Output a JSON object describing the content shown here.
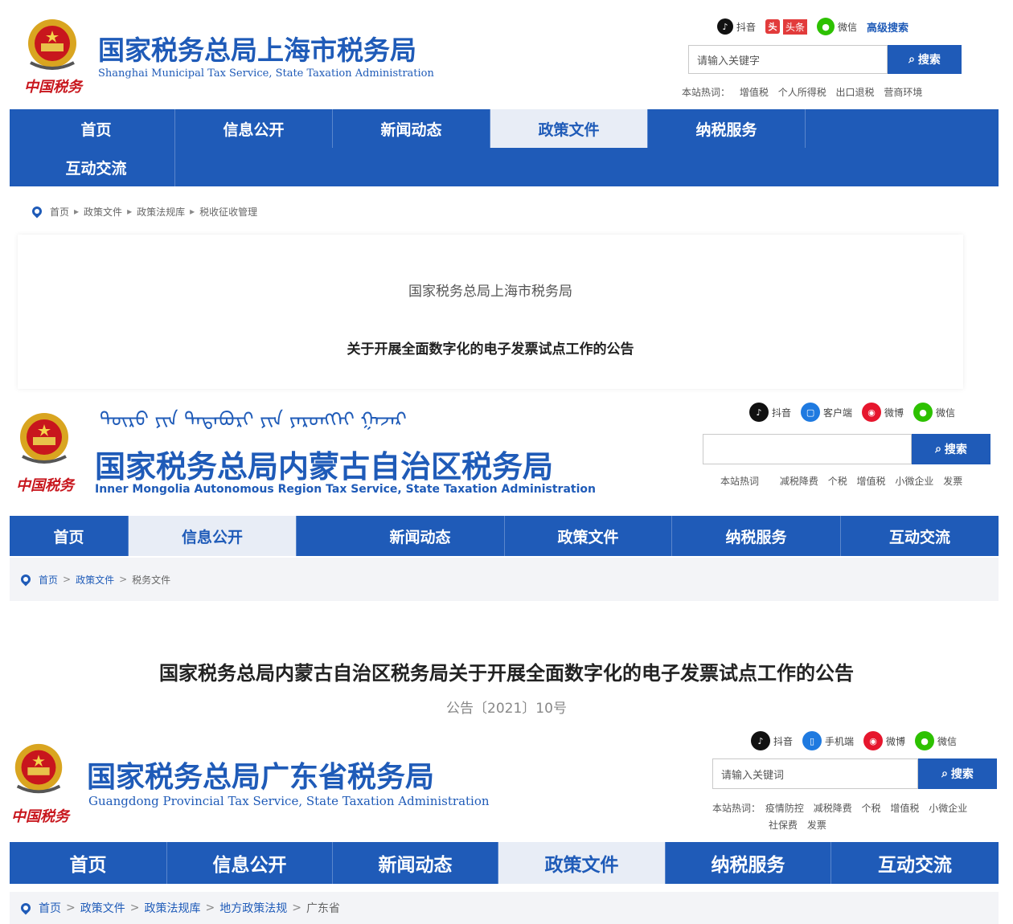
{
  "colors": {
    "brand_blue": "#1f5bb8",
    "calligraphy_red": "#c8161d",
    "nav_active_bg": "#e8edf6"
  },
  "shanghai": {
    "title": "国家税务总局上海市税务局",
    "subtitle": "Shanghai Municipal Tax Service, State Taxation Administration",
    "calligraphy": "中国税务",
    "social": [
      {
        "icon": "douyin-icon",
        "label": "抖音"
      },
      {
        "icon": "headline-icon",
        "label": "头条"
      },
      {
        "icon": "wechat-icon",
        "label": "微信"
      },
      {
        "label": "高级搜索"
      }
    ],
    "search": {
      "placeholder": "请输入关键字",
      "button": "搜索"
    },
    "hot": {
      "label": "本站热词：",
      "items": [
        "增值税",
        "个人所得税",
        "出口退税",
        "营商环境"
      ]
    },
    "nav": [
      "首页",
      "信息公开",
      "新闻动态",
      "政策文件",
      "纳税服务",
      "互动交流"
    ],
    "active_nav": "政策文件",
    "breadcrumb": [
      "首页",
      "政策文件",
      "政策法规库",
      "税收征收管理"
    ],
    "article": {
      "org": "国家税务总局上海市税务局",
      "title": "关于开展全面数字化的电子发票试点工作的公告"
    }
  },
  "inner_mongolia": {
    "mongolian_script": "ᠲᠥᠷᠥ ᠶᠢᠨ ᠲᠠᠲᠠᠪᠤᠷᠢ ᠶᠢᠨ ᠶᠡᠷᠦᠩᠬᠡᠢ ᠭᠠᠵᠠᠷ",
    "title": "国家税务总局内蒙古自治区税务局",
    "subtitle": "Inner Mongolia Autonomous Region Tax Service, State Taxation Administration",
    "calligraphy": "中国税务",
    "social": [
      {
        "icon": "douyin-icon",
        "label": "抖音"
      },
      {
        "icon": "client-icon",
        "label": "客户端"
      },
      {
        "icon": "weibo-icon",
        "label": "微博"
      },
      {
        "icon": "wechat-icon",
        "label": "微信"
      }
    ],
    "search": {
      "placeholder": "",
      "button": "搜索"
    },
    "hot": {
      "label": "本站热词",
      "items": [
        "减税降费",
        "个税",
        "增值税",
        "小微企业",
        "发票"
      ]
    },
    "nav": [
      "首页",
      "信息公开",
      "新闻动态",
      "政策文件",
      "纳税服务",
      "互动交流"
    ],
    "active_nav": "信息公开",
    "breadcrumb": [
      "首页",
      "政策文件",
      "税务文件"
    ],
    "article": {
      "title": "国家税务总局内蒙古自治区税务局关于开展全面数字化的电子发票试点工作的公告",
      "number": "公告〔2021〕10号"
    }
  },
  "guangdong": {
    "title": "国家税务总局广东省税务局",
    "subtitle": "Guangdong Provincial Tax Service, State Taxation Administration",
    "calligraphy": "中国税务",
    "social": [
      {
        "icon": "douyin-icon",
        "label": "抖音"
      },
      {
        "icon": "mobile-icon",
        "label": "手机端"
      },
      {
        "icon": "weibo-icon",
        "label": "微博"
      },
      {
        "icon": "wechat-icon",
        "label": "微信"
      }
    ],
    "search": {
      "placeholder": "请输入关键词",
      "button": "搜索"
    },
    "hot": {
      "label": "本站热词：",
      "items": [
        "疫情防控",
        "减税降费",
        "个税",
        "增值税",
        "小微企业"
      ],
      "items2": [
        "社保费",
        "发票"
      ]
    },
    "nav": [
      "首页",
      "信息公开",
      "新闻动态",
      "政策文件",
      "纳税服务",
      "互动交流"
    ],
    "active_nav": "政策文件",
    "breadcrumb": [
      "首页",
      "政策文件",
      "政策法规库",
      "地方政策法规",
      "广东省"
    ]
  }
}
